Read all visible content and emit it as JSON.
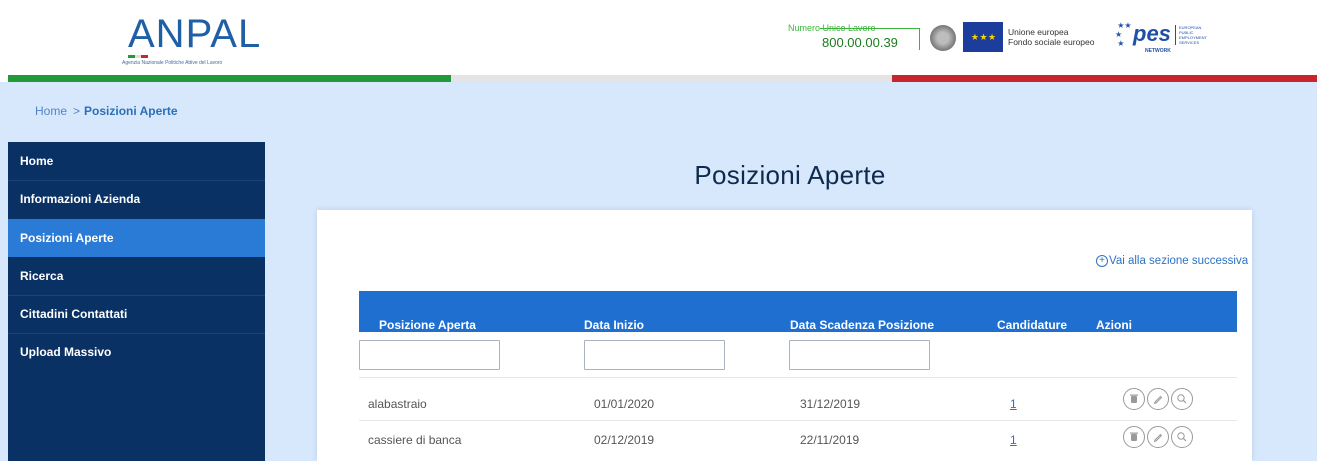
{
  "header": {
    "logo_text": "ANPAL",
    "logo_subtitle": "Agenzia Nazionale Politiche Attive del Lavoro",
    "numero_label": "Numero Unico Lavoro",
    "numero_value": "800.00.00.39",
    "eu_text_line1": "Unione europea",
    "eu_text_line2": "Fondo sociale europeo",
    "pes_text": "pes",
    "pes_side": "EUROPEAN PUBLIC EMPLOYMENT SERVICES",
    "pes_network": "NETWORK"
  },
  "colors": {
    "primary_blue": "#1f6fd1",
    "sidebar_bg": "#0a3164",
    "sidebar_active": "#2a7bd6",
    "band_bg": "#d7e8fd",
    "flag_green": "#239a3a",
    "flag_white": "#e4e4e4",
    "flag_red": "#c8262d"
  },
  "breadcrumb": {
    "home": "Home",
    "separator": ">",
    "current": "Posizioni Aperte"
  },
  "sidebar": {
    "items": [
      {
        "label": "Home"
      },
      {
        "label": "Informazioni Azienda"
      },
      {
        "label": "Posizioni Aperte",
        "active": true
      },
      {
        "label": "Ricerca"
      },
      {
        "label": "Cittadini Contattati"
      },
      {
        "label": "Upload Massivo"
      }
    ]
  },
  "main": {
    "title": "Posizioni Aperte",
    "next_section_link": "Vai alla sezione successiva",
    "table": {
      "headers": [
        "Posizione Aperta",
        "Data Inizio",
        "Data Scadenza Posizione",
        "Candidature",
        "Azioni"
      ],
      "filters": [
        {
          "value": "",
          "placeholder": ""
        },
        {
          "value": "",
          "placeholder": ""
        },
        {
          "value": "",
          "placeholder": ""
        }
      ],
      "rows": [
        {
          "posizione": "alabastraio",
          "data_inizio": "01/01/2020",
          "data_scadenza": "31/12/2019",
          "candidature": "1"
        },
        {
          "posizione": "cassiere di banca",
          "data_inizio": "02/12/2019",
          "data_scadenza": "22/11/2019",
          "candidature": "1"
        }
      ],
      "row_actions": [
        "trash-icon",
        "pencil-icon",
        "search-icon"
      ]
    }
  }
}
